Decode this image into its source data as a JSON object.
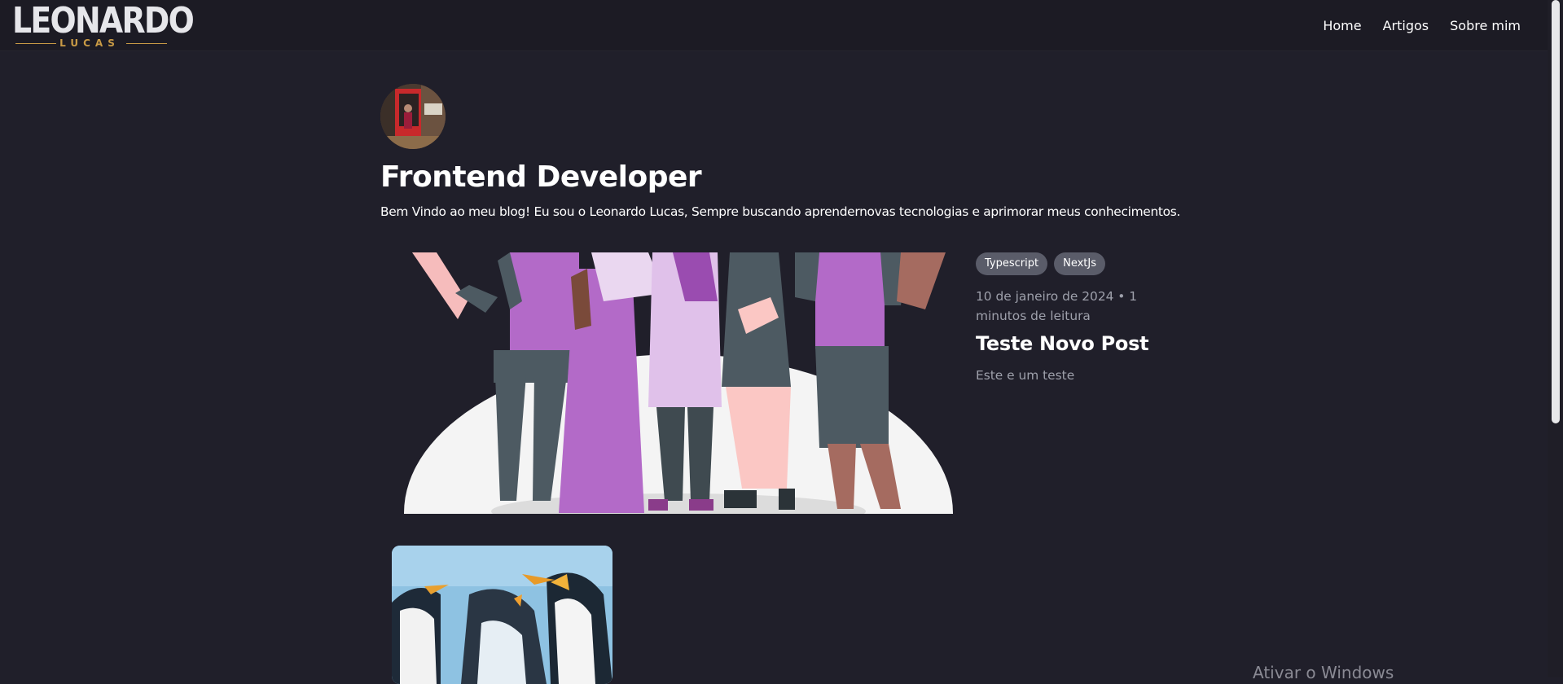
{
  "navbar": {
    "logo_main": "LEONARDO",
    "logo_sub": "LUCAS",
    "links": [
      {
        "label": "Home"
      },
      {
        "label": "Artigos"
      },
      {
        "label": "Sobre mim"
      }
    ]
  },
  "hero": {
    "title": "Frontend Developer",
    "subtitle": "Bem Vindo ao meu blog! Eu sou o Leonardo Lucas, Sempre buscando aprendernovas tecnologias e aprimorar meus conhecimentos."
  },
  "featured_post": {
    "tags": [
      "Typescript",
      "NextJs"
    ],
    "date": "10 de janeiro de 2024 • 1 minutos de leitura",
    "title": "Teste Novo Post",
    "description": "Este e um teste"
  },
  "os_overlay": {
    "watermark": "Ativar o Windows"
  },
  "colors": {
    "background": "#201f2a",
    "navbar": "#1c1b24",
    "tag_bg": "#5a5c69",
    "muted_text": "#9ea0ab",
    "logo_gold": "#c89a45"
  }
}
